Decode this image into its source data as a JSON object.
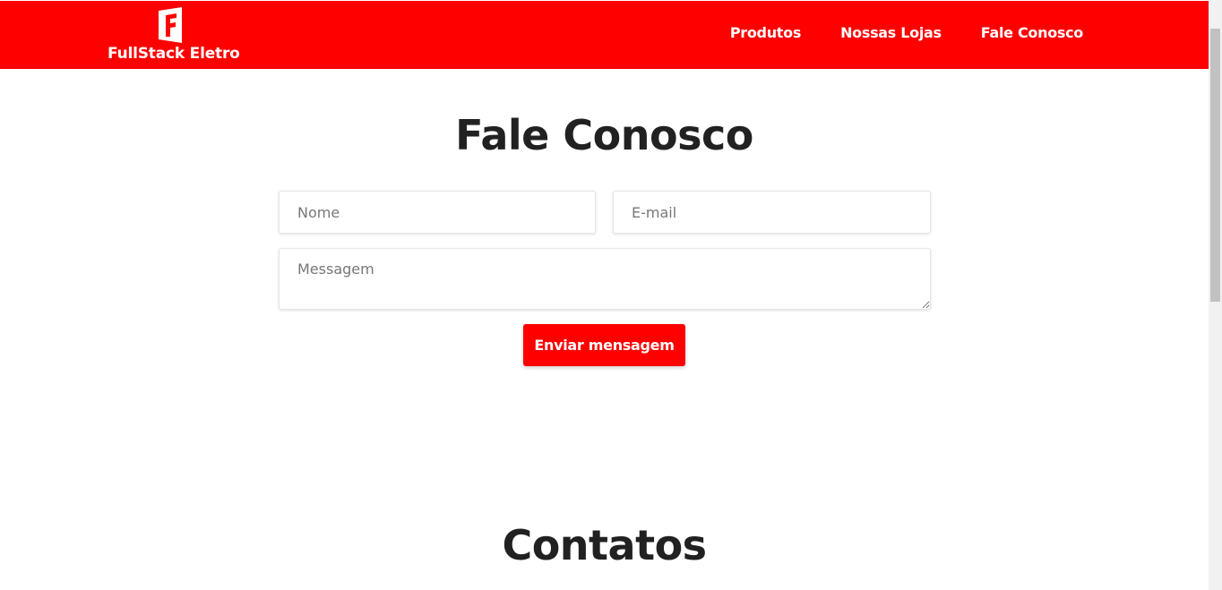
{
  "header": {
    "logo_text": "FullStack Eletro",
    "nav": [
      {
        "label": "Produtos"
      },
      {
        "label": "Nossas Lojas"
      },
      {
        "label": "Fale Conosco"
      }
    ],
    "brand_color": "#ff0000"
  },
  "contact_form": {
    "title": "Fale Conosco",
    "name_placeholder": "Nome",
    "email_placeholder": "E-mail",
    "message_placeholder": "Messagem",
    "submit_label": "Enviar mensagem"
  },
  "contacts": {
    "title": "Contatos"
  }
}
